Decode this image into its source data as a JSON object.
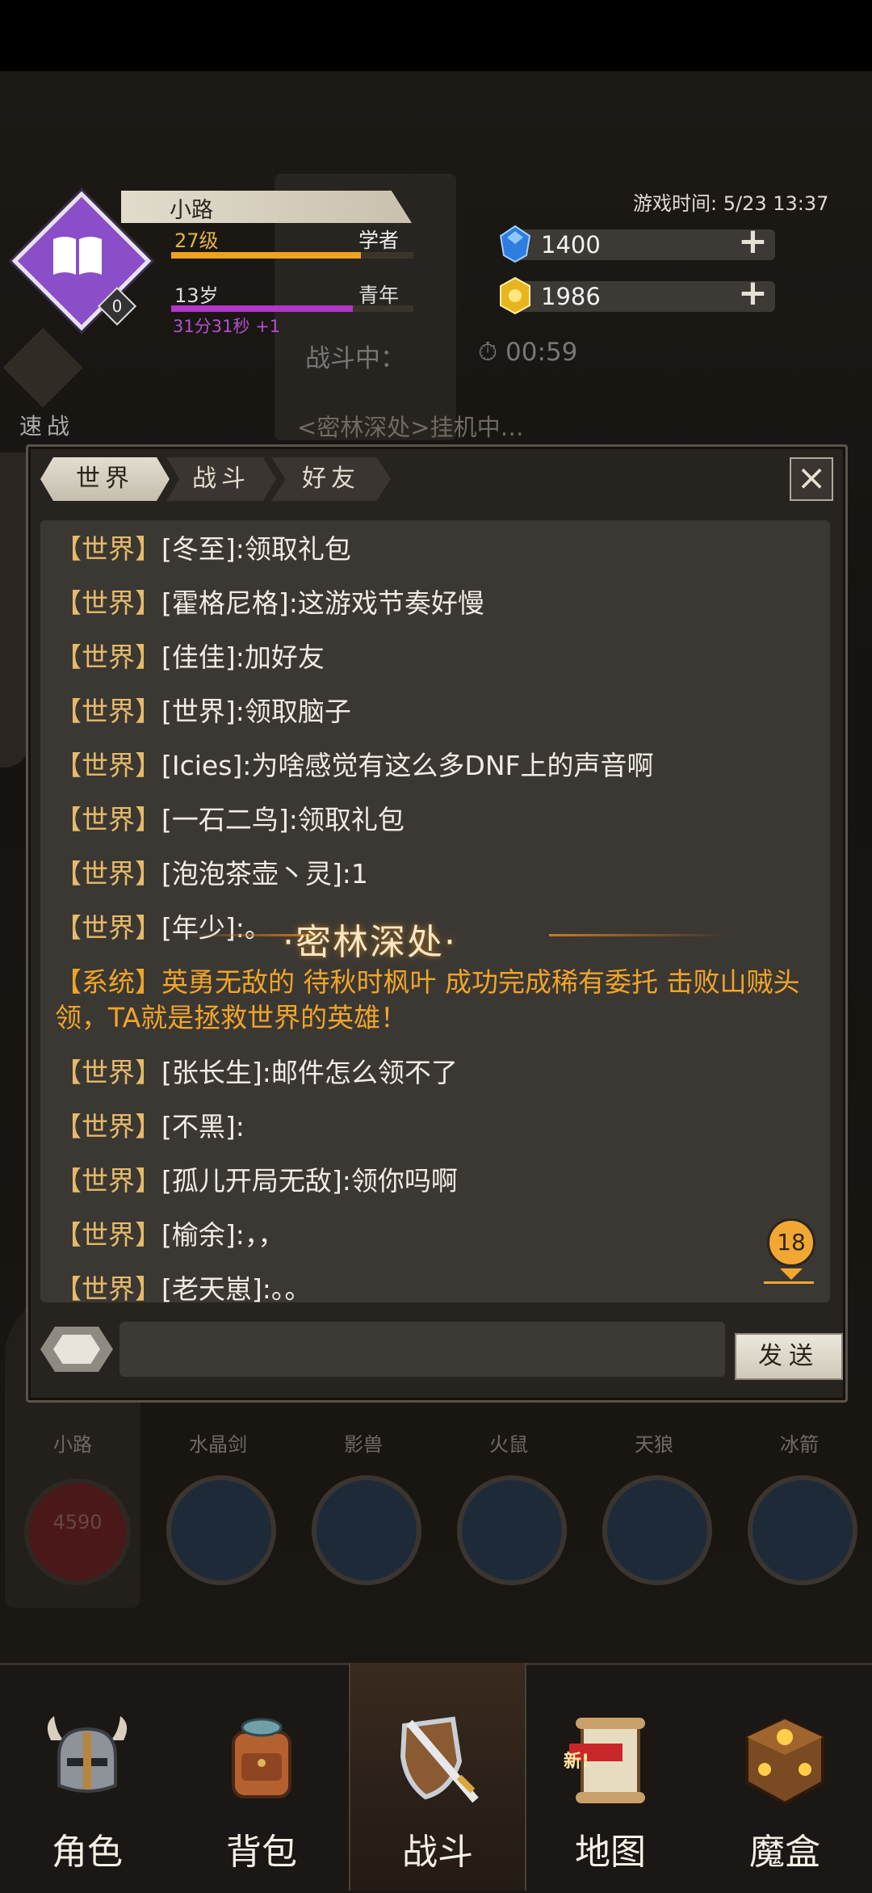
{
  "header": {
    "player_name": "小路",
    "level": "27级",
    "title": "学者",
    "level_progress": 0.78,
    "age": "13岁",
    "life_stage": "青年",
    "age_progress": 0.75,
    "age_timer": "31分31秒",
    "age_timer_bonus": "+1",
    "badge_count": "0",
    "class_icon": "book-icon",
    "game_time": "游戏时间: 5/23 13:37",
    "gems": "1400",
    "gold": "1986",
    "speed_battle_label": "速战",
    "battle_status": "战斗中：",
    "battle_timer": "00:59",
    "afk_text": "<密林深处>挂机中…"
  },
  "chat": {
    "tabs": [
      "世界",
      "战斗",
      "好友"
    ],
    "active_tab": "世界",
    "messages": [
      {
        "tag": "【世界】",
        "text": "[冬至]:领取礼包"
      },
      {
        "tag": "【世界】",
        "text": "[霍格尼格]:这游戏节奏好慢"
      },
      {
        "tag": "【世界】",
        "text": "[佳佳]:加好友"
      },
      {
        "tag": "【世界】",
        "text": "[世界]:领取脑子"
      },
      {
        "tag": "【世界】",
        "text": "[Icies]:为啥感觉有这么多DNF上的声音啊"
      },
      {
        "tag": "【世界】",
        "text": "[一石二鸟]:领取礼包"
      },
      {
        "tag": "【世界】",
        "text": "[泡泡茶壶丶灵]:1"
      },
      {
        "tag": "【世界】",
        "text": "[年少]:。"
      },
      {
        "tag": "【系统】",
        "text": "英勇无敌的 待秋时枫叶 成功完成稀有委托  击败山贼头领，TA就是拯救世界的英雄！"
      },
      {
        "tag": "【世界】",
        "text": "[张长生]:邮件怎么领不了"
      },
      {
        "tag": "【世界】",
        "text": "[不黑]:"
      },
      {
        "tag": "【世界】",
        "text": "[孤儿开局无敌]:领你吗啊"
      },
      {
        "tag": "【世界】",
        "text": "[榆余]:，，"
      },
      {
        "tag": "【世界】",
        "text": "[老天崽]:。。"
      }
    ],
    "area_banner": "密林深处",
    "unread_count": "18",
    "input_value": "",
    "send_label": "发送"
  },
  "skills": {
    "player": {
      "name": "小路",
      "hp": "4590"
    },
    "items": [
      "水晶剑",
      "影兽",
      "火鼠",
      "天狼",
      "冰箭"
    ]
  },
  "nav": {
    "items": [
      {
        "label": "角色",
        "icon": "helmet-icon"
      },
      {
        "label": "背包",
        "icon": "backpack-icon"
      },
      {
        "label": "战斗",
        "icon": "sword-shield-icon"
      },
      {
        "label": "地图",
        "icon": "scroll-map-icon",
        "badge": "新!"
      },
      {
        "label": "魔盒",
        "icon": "magic-box-icon"
      }
    ],
    "active": "战斗"
  },
  "colors": {
    "class_purple": "#8a4fc8",
    "level_bar": "#f0a21f",
    "age_bar": "#b236c9",
    "world_tag": "#e6ba6a",
    "system_msg": "#f0a42a",
    "unread_badge": "#f3a733"
  }
}
